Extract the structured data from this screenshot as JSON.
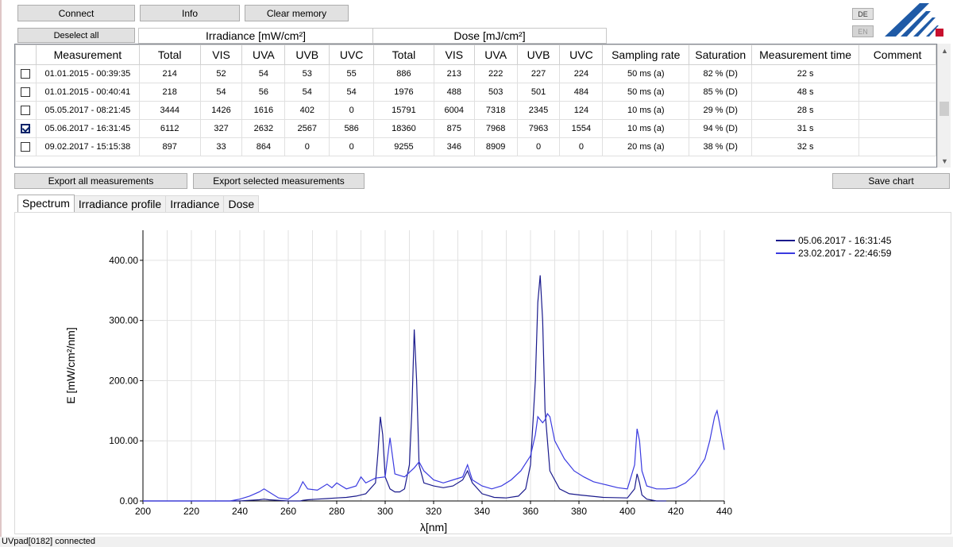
{
  "toolbar": {
    "connect": "Connect",
    "info": "Info",
    "clear_memory": "Clear memory",
    "deselect_all": "Deselect all",
    "lang_de": "DE",
    "lang_en": "EN"
  },
  "groups": {
    "irradiance": "Irradiance [mW/cm²]",
    "dose": "Dose [mJ/cm²]"
  },
  "table": {
    "columns": [
      "",
      "Measurement",
      "Total",
      "VIS",
      "UVA",
      "UVB",
      "UVC",
      "Total",
      "VIS",
      "UVA",
      "UVB",
      "UVC",
      "Sampling rate",
      "Saturation",
      "Measurement time",
      "Comment"
    ],
    "rows": [
      {
        "checked": false,
        "cells": [
          "01.01.2015 - 00:39:35",
          "214",
          "52",
          "54",
          "53",
          "55",
          "886",
          "213",
          "222",
          "227",
          "224",
          "50 ms (a)",
          "82 % (D)",
          "22 s",
          ""
        ]
      },
      {
        "checked": false,
        "cells": [
          "01.01.2015 - 00:40:41",
          "218",
          "54",
          "56",
          "54",
          "54",
          "1976",
          "488",
          "503",
          "501",
          "484",
          "50 ms (a)",
          "85 % (D)",
          "48 s",
          ""
        ]
      },
      {
        "checked": false,
        "cells": [
          "05.05.2017 - 08:21:45",
          "3444",
          "1426",
          "1616",
          "402",
          "0",
          "15791",
          "6004",
          "7318",
          "2345",
          "124",
          "10 ms (a)",
          "29 % (D)",
          "28 s",
          ""
        ]
      },
      {
        "checked": true,
        "cells": [
          "05.06.2017 - 16:31:45",
          "6112",
          "327",
          "2632",
          "2567",
          "586",
          "18360",
          "875",
          "7968",
          "7963",
          "1554",
          "10 ms (a)",
          "94 % (D)",
          "31 s",
          ""
        ]
      },
      {
        "checked": false,
        "cells": [
          "09.02.2017 - 15:15:38",
          "897",
          "33",
          "864",
          "0",
          "0",
          "9255",
          "346",
          "8909",
          "0",
          "0",
          "20 ms (a)",
          "38 % (D)",
          "32 s",
          ""
        ]
      }
    ]
  },
  "actions": {
    "export_all": "Export all measurements",
    "export_selected": "Export selected measurements",
    "save_chart": "Save chart"
  },
  "tabs": [
    "Spectrum",
    "Irradiance profile",
    "Irradiance",
    "Dose"
  ],
  "status": "UVpad[0182] connected",
  "colors": {
    "series1": "#1a1a8c",
    "series2": "#3a3ae0",
    "selected": "#0a246a"
  },
  "chart_data": {
    "type": "line",
    "xlabel": "λ[nm]",
    "ylabel": "E [mW/cm²/nm]",
    "xlim": [
      200,
      440
    ],
    "ylim": [
      0,
      450
    ],
    "xticks": [
      "200",
      "220",
      "240",
      "260",
      "280",
      "300",
      "320",
      "340",
      "360",
      "380",
      "400",
      "420",
      "440"
    ],
    "yticks": [
      "0.00",
      "100.00",
      "200.00",
      "300.00",
      "400.00"
    ],
    "legend": "top-right",
    "grid": true,
    "series": [
      {
        "name": "05.06.2017 - 16:31:45",
        "x": [
          200,
          236,
          240,
          244,
          248,
          250,
          252,
          256,
          260,
          265,
          266,
          268,
          272,
          276,
          280,
          284,
          288,
          290,
          292,
          296,
          297,
          298,
          299,
          300,
          302,
          304,
          306,
          308,
          310,
          311,
          312,
          313,
          314,
          316,
          320,
          324,
          328,
          332,
          334,
          336,
          340,
          345,
          350,
          355,
          358,
          360,
          362,
          363,
          364,
          365,
          366,
          368,
          372,
          376,
          380,
          390,
          400,
          403,
          404,
          405,
          406,
          408,
          412,
          416
        ],
        "y": [
          0,
          0,
          0,
          1,
          2,
          3,
          2,
          1,
          0,
          0,
          1,
          2,
          3,
          4,
          5,
          6,
          8,
          10,
          12,
          30,
          80,
          140,
          110,
          40,
          20,
          15,
          15,
          20,
          60,
          150,
          285,
          200,
          60,
          30,
          25,
          22,
          25,
          35,
          50,
          30,
          12,
          6,
          5,
          8,
          20,
          60,
          200,
          330,
          375,
          300,
          150,
          50,
          20,
          12,
          10,
          6,
          5,
          20,
          45,
          30,
          10,
          3,
          0,
          0
        ]
      },
      {
        "name": "23.02.2017 - 22:46:59",
        "x": [
          200,
          236,
          240,
          244,
          248,
          250,
          252,
          256,
          260,
          264,
          266,
          268,
          272,
          276,
          278,
          280,
          282,
          284,
          288,
          290,
          292,
          296,
          300,
          302,
          304,
          308,
          312,
          314,
          316,
          320,
          324,
          328,
          332,
          334,
          336,
          340,
          344,
          348,
          352,
          356,
          360,
          362,
          363,
          364,
          365,
          366,
          367,
          368,
          370,
          374,
          378,
          382,
          386,
          390,
          396,
          400,
          403,
          404,
          405,
          406,
          408,
          412,
          416,
          420,
          424,
          428,
          432,
          434,
          436,
          437,
          438,
          440
        ],
        "y": [
          0,
          0,
          3,
          8,
          15,
          20,
          15,
          5,
          3,
          15,
          32,
          20,
          18,
          28,
          22,
          30,
          25,
          20,
          25,
          40,
          30,
          38,
          40,
          105,
          45,
          40,
          55,
          65,
          50,
          35,
          30,
          35,
          40,
          60,
          35,
          25,
          20,
          25,
          35,
          50,
          75,
          110,
          140,
          135,
          130,
          135,
          145,
          140,
          100,
          70,
          50,
          40,
          32,
          28,
          22,
          20,
          60,
          120,
          100,
          50,
          25,
          20,
          20,
          22,
          30,
          45,
          70,
          100,
          140,
          150,
          130,
          85
        ]
      }
    ]
  }
}
